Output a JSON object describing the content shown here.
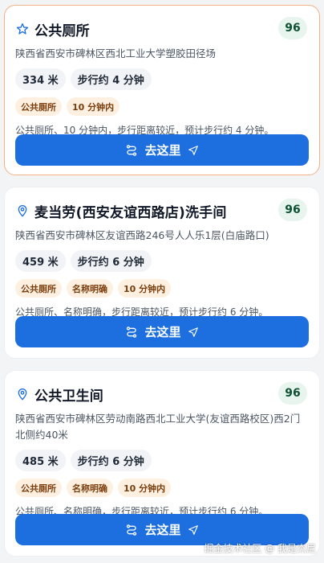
{
  "colors": {
    "accent": "#1d6fe0",
    "highlight_border": "#f4b183",
    "score_bg": "#e7f5ee",
    "tag_bg": "#fdf0e0"
  },
  "cards": [
    {
      "icon": "star-icon",
      "title": "公共厕所",
      "score": "96",
      "address": "陕西省西安市碑林区西北工业大学塑胶田径场",
      "distance": "334 米",
      "walk": "步行约 4 分钟",
      "tags": [
        "公共厕所",
        "10 分钟内"
      ],
      "summary": "公共厕所、10 分钟内，步行距离较近，预计步行约 4 分钟。",
      "button_label": "去这里"
    },
    {
      "icon": "location-pin-icon",
      "title": "麦当劳(西安友谊西路店)洗手间",
      "score": "96",
      "address": "陕西省西安市碑林区友谊西路246号人人乐1层(白庙路口)",
      "distance": "459 米",
      "walk": "步行约 6 分钟",
      "tags": [
        "公共厕所",
        "名称明确",
        "10 分钟内"
      ],
      "summary": "公共厕所、名称明确，步行距离较近，预计步行约 6 分钟。",
      "button_label": "去这里"
    },
    {
      "icon": "location-pin-icon",
      "title": "公共卫生间",
      "score": "96",
      "address": "陕西省西安市碑林区劳动南路西北工业大学(友谊西路校区)西2门北侧约40米",
      "distance": "485 米",
      "walk": "步行约 6 分钟",
      "tags": [
        "公共厕所",
        "名称明确",
        "10 分钟内"
      ],
      "summary": "公共厕所、名称明确，步行距离较近，预计步行约 6 分钟。",
      "button_label": "去这里"
    }
  ],
  "watermark": "掘金技术社区 @ 我是杰尼"
}
